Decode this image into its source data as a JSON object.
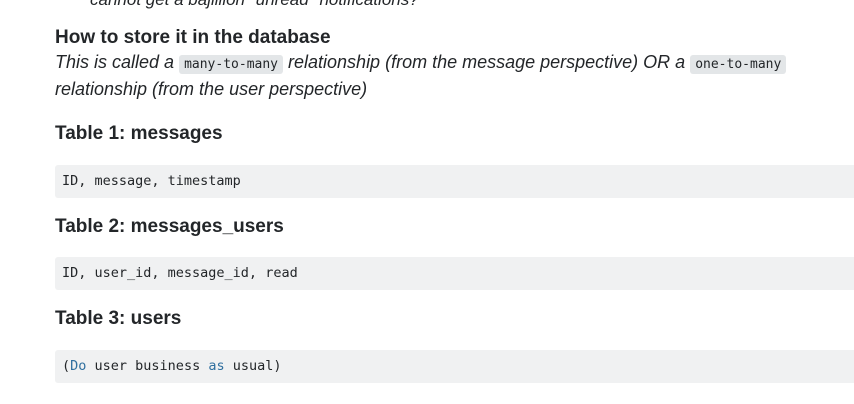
{
  "cut_line": "cannot get a bajillion \"unread\" notifications?",
  "storage_heading": "How to store it in the database",
  "intro": {
    "lead": "This is called a",
    "code1": "many-to-many",
    "middle": "relationship (from the message perspective) OR a",
    "code2": "one-to-many",
    "tail": "relationship (from the user perspective)"
  },
  "tables": [
    {
      "heading": "Table 1: messages",
      "code": "ID, message, timestamp"
    },
    {
      "heading": "Table 2: messages_users",
      "code": "ID, user_id, message_id, read"
    },
    {
      "heading": "Table 3: users",
      "code_open": "(",
      "code_kw1": "Do",
      "code_mid": " user business ",
      "code_kw2": "as",
      "code_end": " usual)"
    }
  ],
  "colors": {
    "code_bg": "#f0f1f2",
    "inline_code_bg": "#e3e6e8",
    "keyword": "#2f6f9f",
    "text": "#232629"
  }
}
